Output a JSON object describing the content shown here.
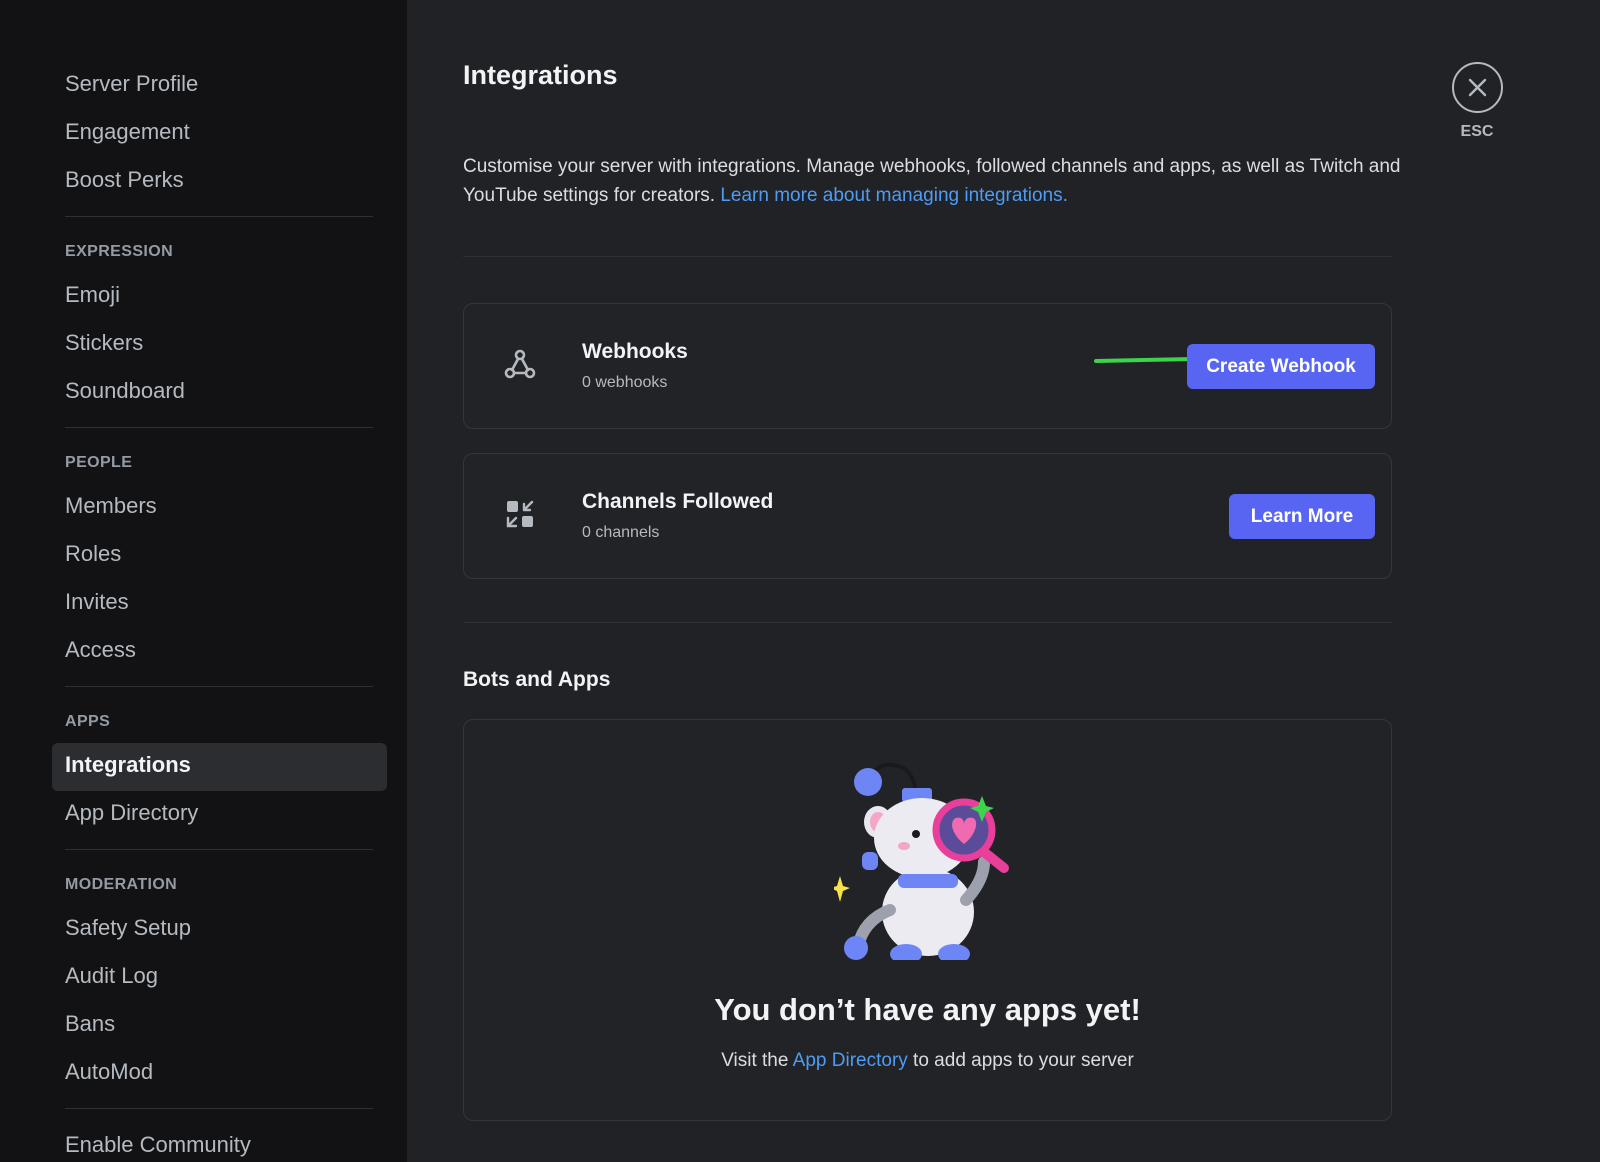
{
  "sidebar": {
    "top_items": [
      "Server Profile",
      "Engagement",
      "Boost Perks"
    ],
    "sections": [
      {
        "header": "EXPRESSION",
        "items": [
          "Emoji",
          "Stickers",
          "Soundboard"
        ]
      },
      {
        "header": "PEOPLE",
        "items": [
          "Members",
          "Roles",
          "Invites",
          "Access"
        ]
      },
      {
        "header": "APPS",
        "items": [
          "Integrations",
          "App Directory"
        ]
      },
      {
        "header": "MODERATION",
        "items": [
          "Safety Setup",
          "Audit Log",
          "Bans",
          "AutoMod"
        ]
      }
    ],
    "bottom_items": [
      "Enable Community"
    ],
    "active_item": "Integrations"
  },
  "main": {
    "title": "Integrations",
    "description": "Customise your server with integrations. Manage webhooks, followed channels and apps, as well as Twitch and YouTube settings for creators.",
    "description_link": "Learn more about managing integrations.",
    "webhooks": {
      "title": "Webhooks",
      "count": "0 webhooks",
      "button": "Create Webhook",
      "icon": "webhook-icon"
    },
    "channels_followed": {
      "title": "Channels Followed",
      "count": "0 channels",
      "button": "Learn More",
      "icon": "channels-followed-icon"
    },
    "bots_section_title": "Bots and Apps",
    "empty_title": "You don’t have any apps yet!",
    "empty_sub_prefix": "Visit the ",
    "empty_sub_link": "App Directory",
    "empty_sub_suffix": " to add apps to your server"
  },
  "close": {
    "label": "ESC",
    "icon": "close-icon"
  },
  "colors": {
    "accent": "#5865f2",
    "link": "#4e9cf5",
    "arrow": "#3bd44a"
  }
}
